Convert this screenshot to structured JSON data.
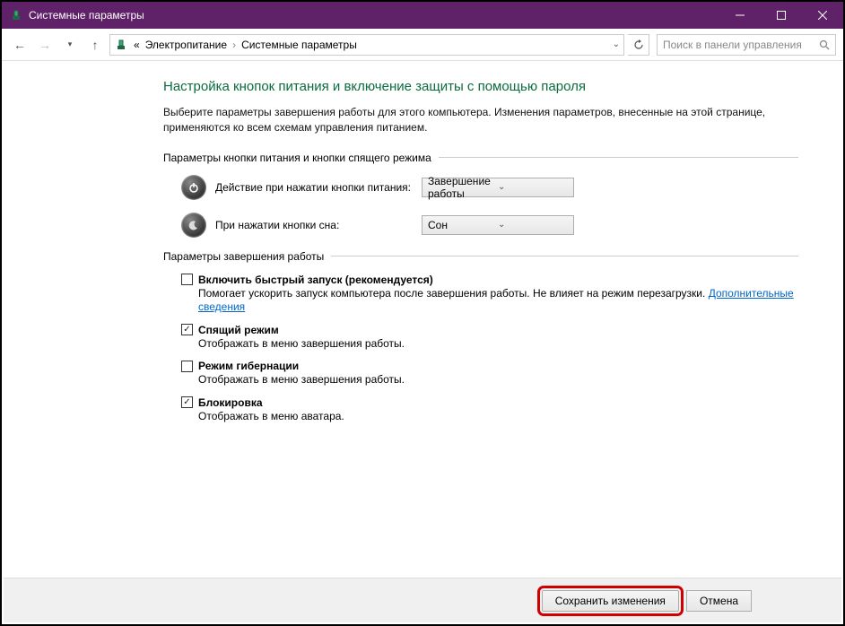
{
  "window": {
    "title": "Системные параметры"
  },
  "breadcrumb": {
    "prefix": "«",
    "item1": "Электропитание",
    "item2": "Системные параметры"
  },
  "search": {
    "placeholder": "Поиск в панели управления"
  },
  "page": {
    "title": "Настройка кнопок питания и включение защиты с помощью пароля",
    "intro": "Выберите параметры завершения работы для этого компьютера. Изменения параметров, внесенные на этой странице, применяются ко всем схемам управления питанием."
  },
  "section1": {
    "header": "Параметры кнопки питания и кнопки спящего режима",
    "power_button_label": "Действие при нажатии кнопки питания:",
    "power_button_value": "Завершение работы",
    "sleep_button_label": "При нажатии кнопки сна:",
    "sleep_button_value": "Сон"
  },
  "section2": {
    "header": "Параметры завершения работы",
    "fast_startup": {
      "title": "Включить быстрый запуск (рекомендуется)",
      "desc_prefix": "Помогает ускорить запуск компьютера после завершения работы. Не влияет на режим перезагрузки. ",
      "link": "Дополнительные сведения",
      "checked": false
    },
    "sleep": {
      "title": "Спящий режим",
      "desc": "Отображать в меню завершения работы.",
      "checked": true
    },
    "hibernate": {
      "title": "Режим гибернации",
      "desc": "Отображать в меню завершения работы.",
      "checked": false
    },
    "lock": {
      "title": "Блокировка",
      "desc": "Отображать в меню аватара.",
      "checked": true
    }
  },
  "footer": {
    "save": "Сохранить изменения",
    "cancel": "Отмена"
  }
}
